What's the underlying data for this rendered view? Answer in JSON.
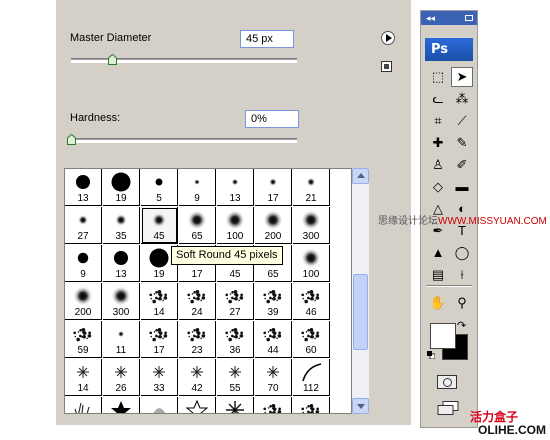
{
  "brush_panel": {
    "master_diameter_label": "Master Diameter",
    "master_diameter_value": "45 px",
    "master_diameter_level": 0.18,
    "hardness_label": "Hardness:",
    "hardness_value": "0%",
    "hardness_level": 0.0
  },
  "presets": [
    {
      "size": "13",
      "kind": "hard"
    },
    {
      "size": "19",
      "kind": "hard"
    },
    {
      "size": "5",
      "kind": "hard"
    },
    {
      "size": "9",
      "kind": "soft"
    },
    {
      "size": "13",
      "kind": "soft"
    },
    {
      "size": "17",
      "kind": "soft"
    },
    {
      "size": "21",
      "kind": "soft"
    },
    {
      "size": "27",
      "kind": "soft"
    },
    {
      "size": "35",
      "kind": "soft"
    },
    {
      "size": "45",
      "kind": "soft",
      "selected": true
    },
    {
      "size": "65",
      "kind": "soft"
    },
    {
      "size": "100",
      "kind": "soft"
    },
    {
      "size": "200",
      "kind": "soft"
    },
    {
      "size": "300",
      "kind": "soft"
    },
    {
      "size": "9",
      "kind": "hard"
    },
    {
      "size": "13",
      "kind": "hard"
    },
    {
      "size": "19",
      "kind": "hard"
    },
    {
      "size": "17",
      "kind": "soft"
    },
    {
      "size": "45",
      "kind": "soft"
    },
    {
      "size": "65",
      "kind": "soft"
    },
    {
      "size": "100",
      "kind": "soft"
    },
    {
      "size": "200",
      "kind": "soft"
    },
    {
      "size": "300",
      "kind": "soft"
    },
    {
      "size": "14",
      "kind": "splat"
    },
    {
      "size": "24",
      "kind": "splat"
    },
    {
      "size": "27",
      "kind": "splat"
    },
    {
      "size": "39",
      "kind": "splat"
    },
    {
      "size": "46",
      "kind": "splat"
    },
    {
      "size": "59",
      "kind": "splat"
    },
    {
      "size": "11",
      "kind": "soft"
    },
    {
      "size": "17",
      "kind": "splat"
    },
    {
      "size": "23",
      "kind": "splat"
    },
    {
      "size": "36",
      "kind": "splat"
    },
    {
      "size": "44",
      "kind": "splat"
    },
    {
      "size": "60",
      "kind": "splat"
    },
    {
      "size": "14",
      "kind": "star"
    },
    {
      "size": "26",
      "kind": "star"
    },
    {
      "size": "33",
      "kind": "star"
    },
    {
      "size": "42",
      "kind": "star"
    },
    {
      "size": "55",
      "kind": "star"
    },
    {
      "size": "70",
      "kind": "star"
    },
    {
      "size": "112",
      "kind": "stroke"
    },
    {
      "size": "",
      "kind": "grass"
    },
    {
      "size": "",
      "kind": "starsolid"
    },
    {
      "size": "",
      "kind": "leaf"
    },
    {
      "size": "",
      "kind": "staroutline"
    },
    {
      "size": "",
      "kind": "burst"
    },
    {
      "size": "",
      "kind": "splat"
    },
    {
      "size": "",
      "kind": "splat"
    }
  ],
  "tooltip": "Soft Round 45 pixels",
  "toolbar": {
    "header": "◂◂",
    "logo": "Ps",
    "tools": [
      {
        "name": "marquee-tool",
        "glyph": "⬚"
      },
      {
        "name": "move-tool",
        "glyph": "➤",
        "active": true
      },
      {
        "name": "lasso-tool",
        "glyph": "ᓚ"
      },
      {
        "name": "magic-wand-tool",
        "glyph": "⁂"
      },
      {
        "name": "crop-tool",
        "glyph": "⌗"
      },
      {
        "name": "slice-tool",
        "glyph": "⟋"
      },
      {
        "name": "healing-brush-tool",
        "glyph": "✚"
      },
      {
        "name": "brush-tool",
        "glyph": "✎"
      },
      {
        "name": "clone-stamp-tool",
        "glyph": "♙"
      },
      {
        "name": "history-brush-tool",
        "glyph": "✐"
      },
      {
        "name": "eraser-tool",
        "glyph": "◇"
      },
      {
        "name": "gradient-tool",
        "glyph": "▬"
      },
      {
        "name": "blur-tool",
        "glyph": "△"
      },
      {
        "name": "dodge-tool",
        "glyph": "◐"
      },
      {
        "name": "pen-tool",
        "glyph": "✒"
      },
      {
        "name": "type-tool",
        "glyph": "T"
      },
      {
        "name": "path-selection-tool",
        "glyph": "▲"
      },
      {
        "name": "shape-tool",
        "glyph": "◯"
      },
      {
        "name": "notes-tool",
        "glyph": "▤"
      },
      {
        "name": "eyedropper-tool",
        "glyph": "⟊"
      },
      {
        "name": "hand-tool",
        "glyph": "✋"
      },
      {
        "name": "zoom-tool",
        "glyph": "⚲"
      }
    ]
  },
  "watermark": {
    "side": "思缘设计论坛",
    "side_site": "WWW.MISSYUAN.COM",
    "brand": "活力盒子",
    "site": "OLIHE.COM"
  },
  "colors": {
    "accent": "#3b62b5",
    "foreground": "#ffffff",
    "background": "#000000"
  }
}
